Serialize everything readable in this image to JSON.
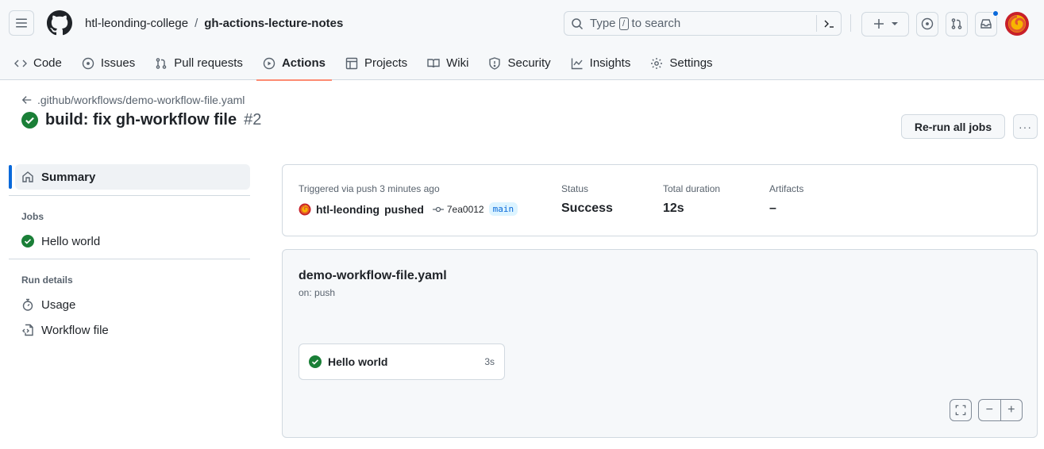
{
  "header": {
    "org": "htl-leonding-college",
    "separator": "/",
    "repo": "gh-actions-lecture-notes",
    "search": {
      "prefix": "Type",
      "key": "/",
      "suffix": "to search"
    },
    "notification_dot_color": "#0969da"
  },
  "tabs": [
    {
      "label": "Code",
      "icon": "code-icon"
    },
    {
      "label": "Issues",
      "icon": "issue-icon"
    },
    {
      "label": "Pull requests",
      "icon": "pull-request-icon"
    },
    {
      "label": "Actions",
      "icon": "play-icon",
      "active": true
    },
    {
      "label": "Projects",
      "icon": "table-icon"
    },
    {
      "label": "Wiki",
      "icon": "book-icon"
    },
    {
      "label": "Security",
      "icon": "shield-icon"
    },
    {
      "label": "Insights",
      "icon": "graph-icon"
    },
    {
      "label": "Settings",
      "icon": "gear-icon"
    }
  ],
  "run": {
    "workflow_path": ".github/workflows/demo-workflow-file.yaml",
    "title": "build: fix gh-workflow file",
    "number": "#2",
    "rerun_label": "Re-run all jobs",
    "more_label": "···"
  },
  "sidebar": {
    "summary_label": "Summary",
    "jobs_heading": "Jobs",
    "jobs": [
      {
        "label": "Hello world",
        "status": "success"
      }
    ],
    "details_heading": "Run details",
    "details": [
      {
        "label": "Usage",
        "icon": "stopwatch-icon"
      },
      {
        "label": "Workflow file",
        "icon": "file-code-icon"
      }
    ]
  },
  "summary": {
    "trigger_label": "Triggered via push 3 minutes ago",
    "actor": "htl-leonding",
    "action": "pushed",
    "commit": "7ea0012",
    "branch": "main",
    "status_label": "Status",
    "status_value": "Success",
    "duration_label": "Total duration",
    "duration_value": "12s",
    "artifacts_label": "Artifacts",
    "artifacts_value": "–"
  },
  "graph": {
    "workflow_file": "demo-workflow-file.yaml",
    "trigger": "on: push",
    "job_name": "Hello world",
    "job_duration": "3s",
    "zoom_out": "−",
    "zoom_in": "+"
  },
  "colors": {
    "success": "#1a7f37",
    "accent": "#0969da",
    "active_tab_underline": "#fd8c73"
  }
}
